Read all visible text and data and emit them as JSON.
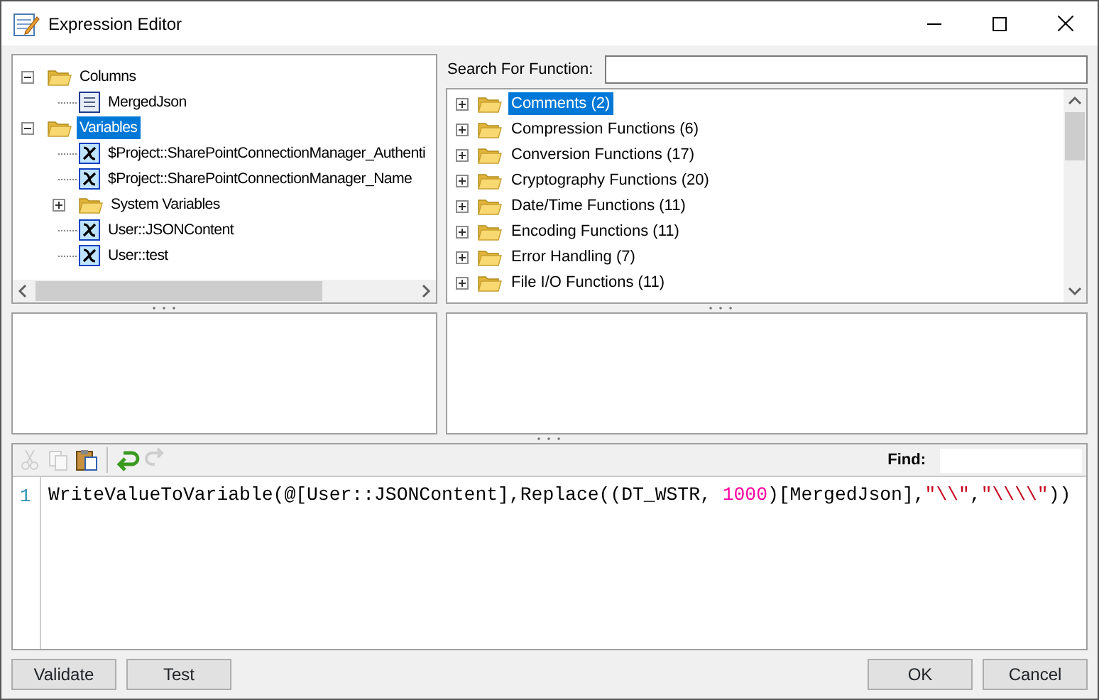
{
  "window": {
    "title": "Expression Editor"
  },
  "variables_tree": [
    {
      "label": "Columns",
      "kind": "folder",
      "expanded": true,
      "selected": false,
      "children": [
        {
          "label": "MergedJson",
          "kind": "column",
          "selected": false
        }
      ]
    },
    {
      "label": "Variables",
      "kind": "folder",
      "expanded": true,
      "selected": true,
      "children": [
        {
          "label": "$Project::SharePointConnectionManager_Authenti",
          "kind": "variable",
          "selected": false
        },
        {
          "label": "$Project::SharePointConnectionManager_Name",
          "kind": "variable",
          "selected": false
        },
        {
          "label": "System Variables",
          "kind": "folder",
          "expanded": false,
          "selected": false
        },
        {
          "label": "User::JSONContent",
          "kind": "variable",
          "selected": false
        },
        {
          "label": "User::test",
          "kind": "variable",
          "selected": false
        }
      ]
    }
  ],
  "search": {
    "label": "Search For Function:"
  },
  "functions_tree": [
    {
      "label": "Comments (2)",
      "selected": true
    },
    {
      "label": "Compression Functions (6)",
      "selected": false
    },
    {
      "label": "Conversion Functions (17)",
      "selected": false
    },
    {
      "label": "Cryptography Functions (20)",
      "selected": false
    },
    {
      "label": "Date/Time Functions (11)",
      "selected": false
    },
    {
      "label": "Encoding Functions (11)",
      "selected": false
    },
    {
      "label": "Error Handling (7)",
      "selected": false
    },
    {
      "label": "File I/O Functions (11)",
      "selected": false
    }
  ],
  "toolbar": [
    {
      "kind": "cut",
      "disabled": true
    },
    {
      "kind": "copy",
      "disabled": true
    },
    {
      "kind": "paste",
      "disabled": false
    },
    {
      "kind": "undo",
      "disabled": false
    },
    {
      "kind": "redo",
      "disabled": true
    }
  ],
  "find": {
    "label": "Find:"
  },
  "code_lines": [
    {
      "number": "1",
      "tokens": [
        {
          "kind": "text",
          "text": "WriteValueToVariable(@[User::JSONContent],Replace((DT_WSTR, "
        },
        {
          "kind": "number",
          "text": "1000"
        },
        {
          "kind": "text",
          "text": ")[MergedJson],"
        },
        {
          "kind": "string",
          "text": "\"\\\\\""
        },
        {
          "kind": "text",
          "text": ","
        },
        {
          "kind": "string",
          "text": "\"\\\\\\\\\""
        },
        {
          "kind": "text",
          "text": "))"
        }
      ]
    }
  ],
  "buttons_left": [
    "Validate",
    "Test"
  ],
  "buttons_right": [
    "OK",
    "Cancel"
  ]
}
